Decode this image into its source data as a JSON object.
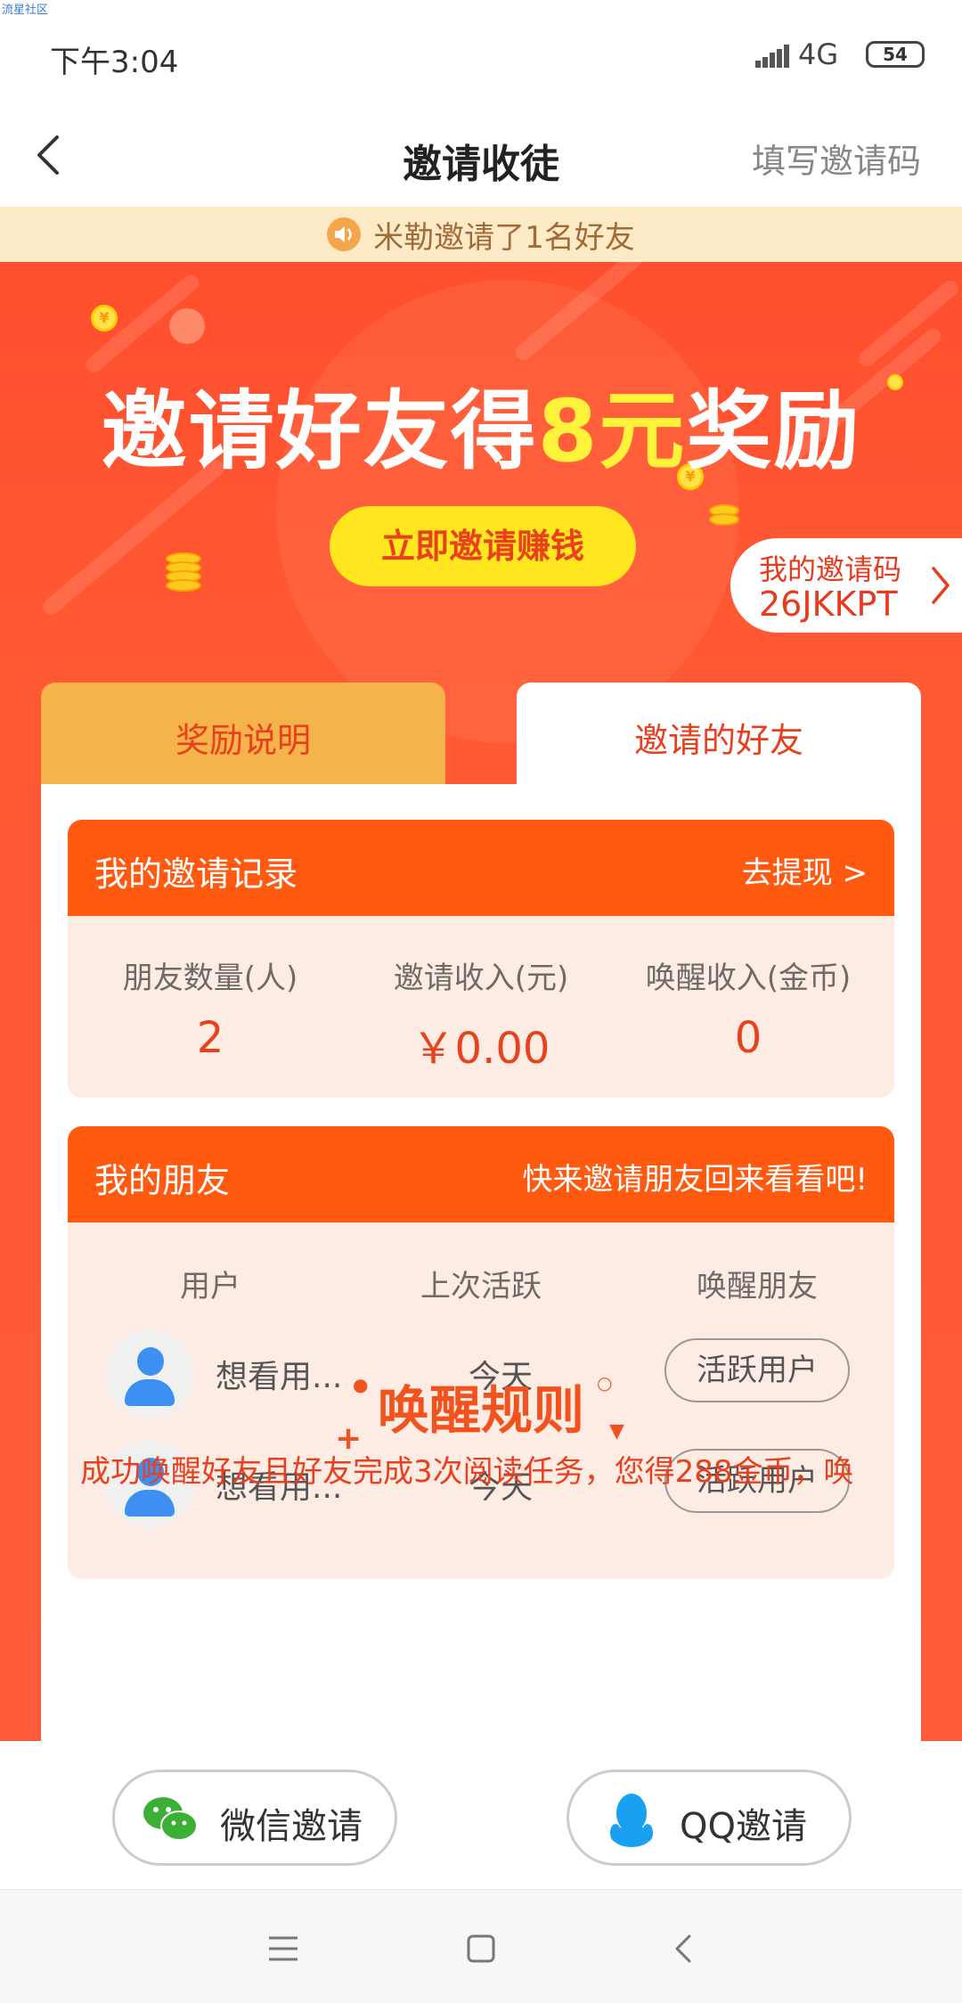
{
  "status_bar": {
    "watermark": "流星社区",
    "time": "下午3:04",
    "network": "4G",
    "battery": "54"
  },
  "header": {
    "title": "邀请收徒",
    "fill_code": "填写邀请码"
  },
  "notice": {
    "text": "米勒邀请了1名好友"
  },
  "banner": {
    "title_part1": "邀请好友得",
    "title_highlight": "8元",
    "title_part2": "奖励",
    "invite_button": "立即邀请赚钱",
    "code_label": "我的邀请码",
    "code_value": "26JKKPT"
  },
  "tabs": [
    {
      "label": "奖励说明"
    },
    {
      "label": "邀请的好友"
    }
  ],
  "invite_record": {
    "title": "我的邀请记录",
    "link": "去提现 >",
    "stats": [
      {
        "label": "朋友数量(人)",
        "value": "2"
      },
      {
        "label": "邀请收入(元)",
        "value": "￥0.00"
      },
      {
        "label": "唤醒收入(金币)",
        "value": "0"
      }
    ]
  },
  "friends": {
    "title": "我的朋友",
    "subtitle": "快来邀请朋友回来看看吧!",
    "columns": [
      "用户",
      "上次活跃",
      "唤醒朋友"
    ],
    "rows": [
      {
        "name": "想看用...",
        "last_active": "今天",
        "action": "活跃用户"
      },
      {
        "name": "想看用...",
        "last_active": "今天",
        "action": "活跃用户"
      }
    ]
  },
  "rules": {
    "title": "唤醒规则",
    "text": "成功唤醒好友且好友完成3次阅读任务，您得288金币，唤"
  },
  "share": {
    "wechat": "微信邀请",
    "qq": "QQ邀请"
  },
  "colors": {
    "accent": "#ff5a10",
    "banner": "#ff5034",
    "highlight": "#fff23a",
    "tab_inactive": "#f5b34b"
  }
}
